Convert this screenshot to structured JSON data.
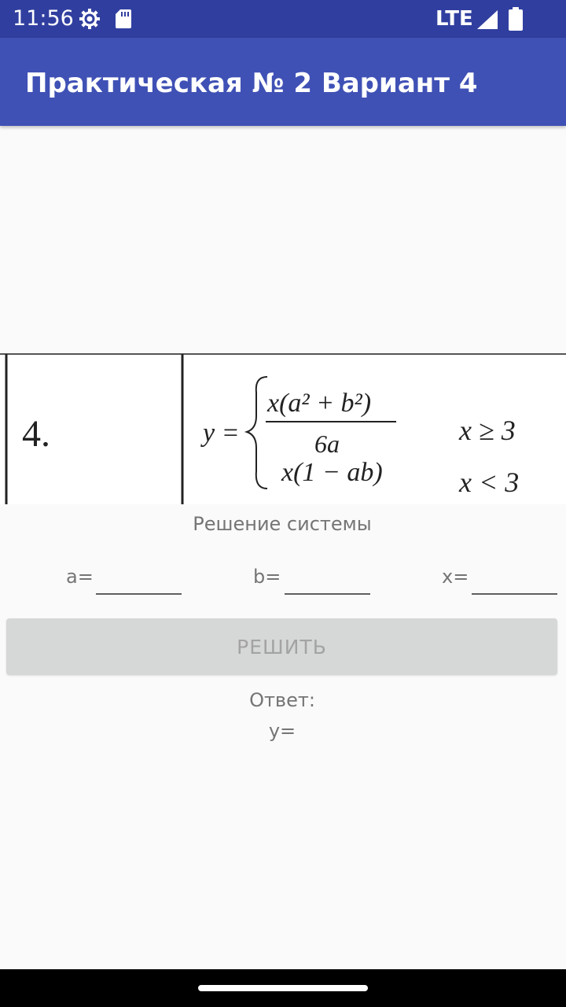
{
  "status_bar": {
    "time": "11:56",
    "network": "LTE",
    "icons": [
      "settings-gear-icon",
      "sd-card-icon",
      "signal-icon",
      "battery-icon"
    ],
    "background": "#303f9f"
  },
  "app_bar": {
    "title": "Практическая № 2 Вариант 4",
    "background": "#3f51b5"
  },
  "formula": {
    "number": "4.",
    "lhs": "y =",
    "case1_numerator": "x(a² + b²)",
    "case1_denominator": "6a",
    "case2_expression": "x(1 − ab)",
    "case1_condition": "x ≥ 3",
    "case2_condition": "x < 3"
  },
  "main": {
    "subtitle": "Решение системы",
    "fields": {
      "a_label": "a=",
      "b_label": "b=",
      "x_label": "x=",
      "a_value": "",
      "b_value": "",
      "x_value": ""
    },
    "solve_button": "РЕШИТЬ",
    "answer_label": "Ответ:",
    "result_label": "y="
  },
  "colors": {
    "page_background": "#fafafa",
    "secondary_text": "#757575",
    "button_disabled": "#d6d7d7"
  }
}
